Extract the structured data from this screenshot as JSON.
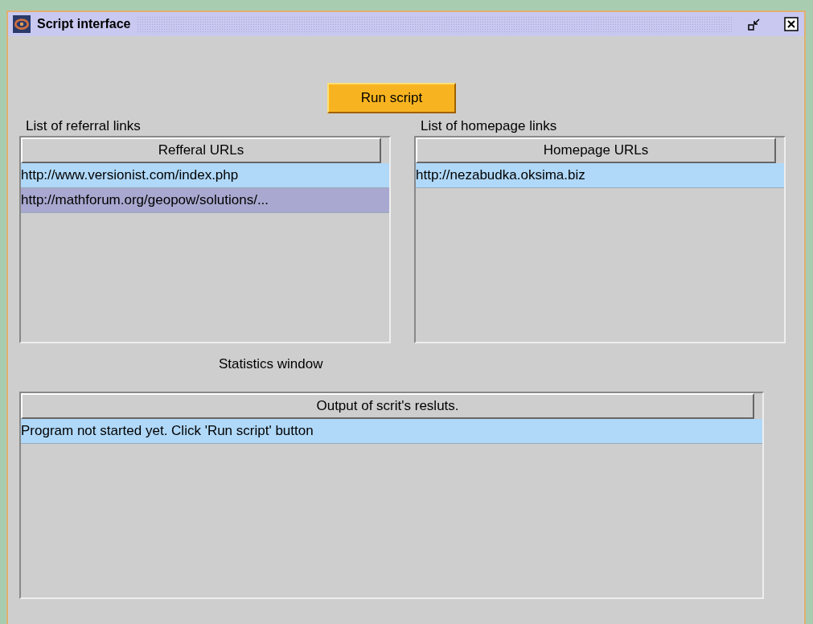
{
  "window": {
    "title": "Script interface"
  },
  "run_button": {
    "label": "Run script"
  },
  "referral": {
    "label": "List of referral links",
    "column": "Refferal URLs",
    "rows": [
      {
        "text": "http://www.versionist.com/index.php",
        "selected": false
      },
      {
        "text": "http://mathforum.org/geopow/solutions/...",
        "selected": true
      }
    ]
  },
  "homepage": {
    "label": "List of homepage links",
    "column": "Homepage URLs",
    "rows": [
      {
        "text": "http://nezabudka.oksima.biz",
        "selected": false
      }
    ]
  },
  "statistics": {
    "label": "Statistics window",
    "column": "Output of scrit's resluts.",
    "rows": [
      {
        "text": "Program not started yet. Click 'Run script' button",
        "selected": false
      }
    ]
  }
}
